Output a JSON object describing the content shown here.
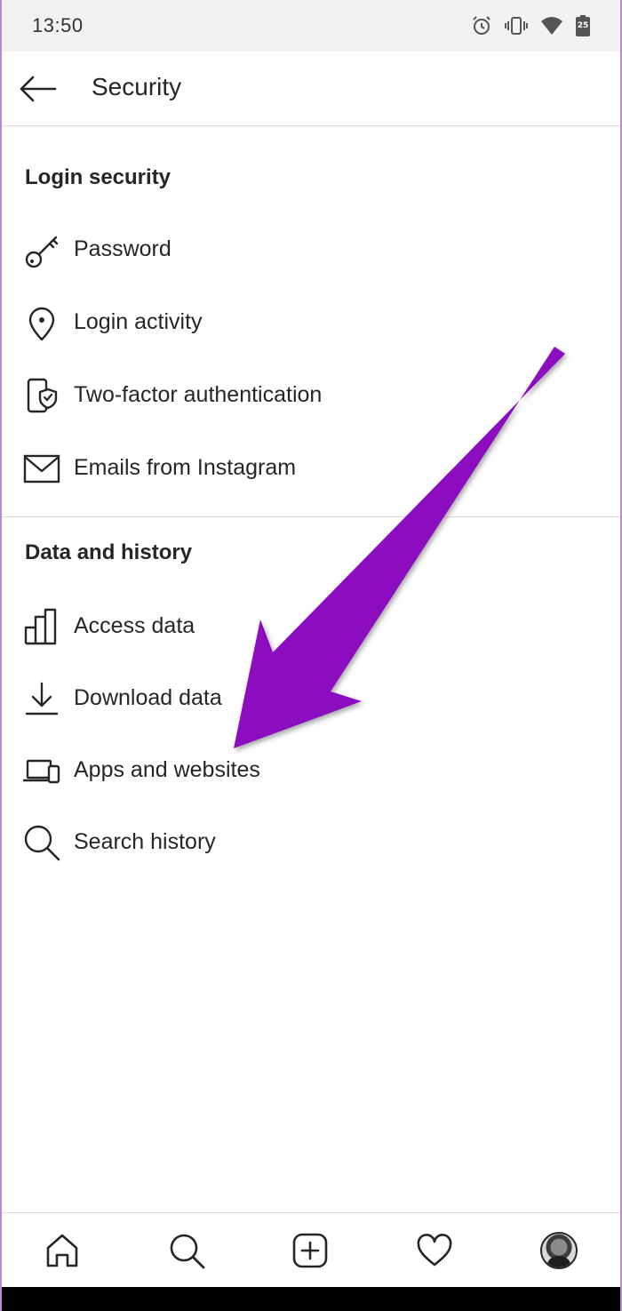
{
  "status_bar": {
    "time": "13:50",
    "icons": [
      "alarm-icon",
      "vibrate-icon",
      "wifi-icon",
      "battery-icon"
    ],
    "battery_label": "25"
  },
  "header": {
    "title": "Security",
    "back_icon": "arrow-left-icon"
  },
  "sections": [
    {
      "title": "Login security",
      "items": [
        {
          "label": "Password",
          "icon": "key-icon"
        },
        {
          "label": "Login activity",
          "icon": "location-pin-icon"
        },
        {
          "label": "Two-factor authentication",
          "icon": "phone-shield-icon"
        },
        {
          "label": "Emails from Instagram",
          "icon": "envelope-icon"
        }
      ]
    },
    {
      "title": "Data and history",
      "items": [
        {
          "label": "Access data",
          "icon": "bar-chart-icon"
        },
        {
          "label": "Download data",
          "icon": "download-icon"
        },
        {
          "label": "Apps and websites",
          "icon": "laptop-phone-icon"
        },
        {
          "label": "Search history",
          "icon": "search-icon"
        }
      ]
    }
  ],
  "bottom_nav": {
    "items": [
      "home-icon",
      "search-icon",
      "new-post-icon",
      "activity-heart-icon",
      "profile-avatar"
    ]
  },
  "colors": {
    "annotation_arrow": "#8b0fbf",
    "text": "#262626",
    "divider": "#dbdbdb"
  }
}
